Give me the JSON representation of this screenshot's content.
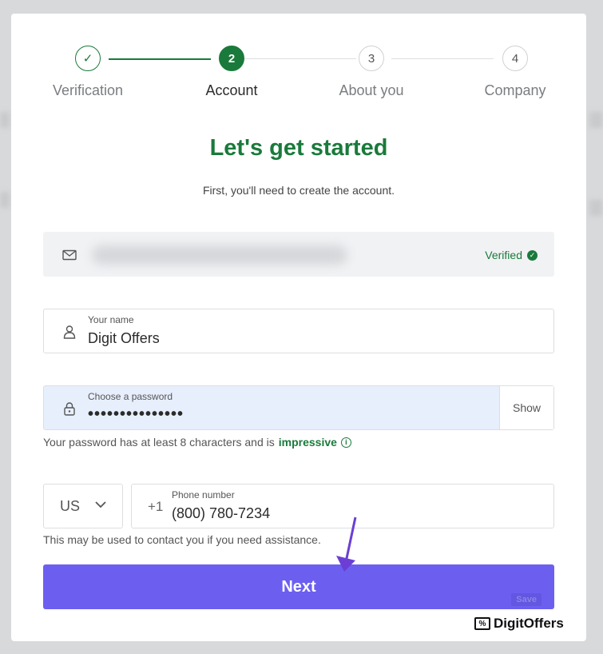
{
  "stepper": {
    "steps": [
      {
        "label": "Verification",
        "marker": "✓",
        "state": "done"
      },
      {
        "label": "Account",
        "marker": "2",
        "state": "active"
      },
      {
        "label": "About you",
        "marker": "3",
        "state": "pending"
      },
      {
        "label": "Company",
        "marker": "4",
        "state": "pending"
      }
    ]
  },
  "header": {
    "title": "Let's get started",
    "subtitle": "First, you'll need to create the account."
  },
  "email": {
    "icon": "mail-icon",
    "status": "Verified"
  },
  "name": {
    "icon": "user-icon",
    "label": "Your name",
    "value": "Digit Offers"
  },
  "password": {
    "icon": "lock-icon",
    "label": "Choose a password",
    "value": "•••••••••••••••",
    "show_label": "Show",
    "hint_prefix": "Your password has at least 8 characters and is",
    "strength": "impressive"
  },
  "phone": {
    "country": "US",
    "prefix": "+1",
    "label": "Phone number",
    "value": "(800) 780-7234",
    "hint": "This may be used to contact you if you need assistance."
  },
  "actions": {
    "next_label": "Next",
    "save_label": "Save"
  },
  "watermark": {
    "icon_text": "%",
    "text": "DigitOffers"
  },
  "colors": {
    "accent_green": "#1a7a3b",
    "primary_button": "#6c5ff0",
    "password_bg": "#e7effd"
  }
}
